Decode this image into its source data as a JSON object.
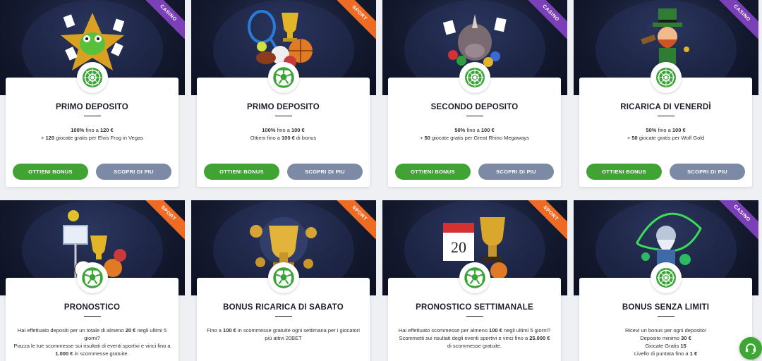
{
  "colors": {
    "accent_green": "#41a334",
    "button_grey": "#7d8aa5",
    "casino_ribbon": "#7b3fb8",
    "sport_ribbon": "#ef6a23",
    "hero_bg": "#141a30"
  },
  "cards": [
    {
      "ribbon": "CASINO",
      "ribbon_type": "casino",
      "icon": "roulette-icon",
      "art": "frog-casino-art",
      "title": "PRIMO DEPOSITO",
      "desc": [
        [
          {
            "t": "100%",
            "b": true
          },
          {
            "t": " fino a "
          },
          {
            "t": "120 €",
            "b": true
          }
        ],
        [
          {
            "t": "+ "
          },
          {
            "t": "120",
            "b": true
          },
          {
            "t": " giocate gratis per Elvis Frog in Vegas"
          }
        ]
      ],
      "buttons": {
        "primary": "OTTIENI BONUS",
        "secondary": "SCOPRI DI PIU"
      }
    },
    {
      "ribbon": "SPORT",
      "ribbon_type": "sport",
      "icon": "soccer-ball-icon",
      "art": "sports-balls-art",
      "title": "PRIMO DEPOSITO",
      "desc": [
        [
          {
            "t": "100%",
            "b": true
          },
          {
            "t": " fino a "
          },
          {
            "t": "100 €",
            "b": true
          }
        ],
        [
          {
            "t": "Ottieni fino a "
          },
          {
            "t": "100 €",
            "b": true
          },
          {
            "t": " di bonus"
          }
        ]
      ],
      "buttons": {
        "primary": "OTTIENI BONUS",
        "secondary": "SCOPRI DI PIU"
      }
    },
    {
      "ribbon": "CASINO",
      "ribbon_type": "casino",
      "icon": "roulette-icon",
      "art": "rhino-casino-art",
      "title": "SECONDO DEPOSITO",
      "desc": [
        [
          {
            "t": "50%",
            "b": true
          },
          {
            "t": " fino a "
          },
          {
            "t": "100 €",
            "b": true
          }
        ],
        [
          {
            "t": "+ "
          },
          {
            "t": "50",
            "b": true
          },
          {
            "t": " giocate gratis per Great Rhino Megaways"
          }
        ]
      ],
      "buttons": {
        "primary": "OTTIENI BONUS",
        "secondary": "SCOPRI DI PIU"
      }
    },
    {
      "ribbon": "CASINO",
      "ribbon_type": "casino",
      "icon": "roulette-icon",
      "art": "leprechaun-casino-art",
      "title": "RICARICA DI VENERDÌ",
      "desc": [
        [
          {
            "t": "50%",
            "b": true
          },
          {
            "t": " fino a "
          },
          {
            "t": "100 €",
            "b": true
          }
        ],
        [
          {
            "t": "+ "
          },
          {
            "t": "50",
            "b": true
          },
          {
            "t": " giocate gratis per Wolf Gold"
          }
        ]
      ],
      "buttons": {
        "primary": "OTTIENI BONUS",
        "secondary": "SCOPRI DI PIU"
      }
    },
    {
      "ribbon": "SPORT",
      "ribbon_type": "sport",
      "icon": "soccer-ball-icon",
      "art": "sports-equipment-art",
      "title": "PRONOSTICO",
      "desc": [
        [
          {
            "t": "Hai effettuato depositi per un totale di almeno "
          },
          {
            "t": "20 €",
            "b": true
          },
          {
            "t": " negli ultimi 5 giorni?"
          }
        ],
        [
          {
            "t": "Piazza le tue scommesse sui risultati di eventi sportivi e vinci fino a "
          },
          {
            "t": "1.000 €",
            "b": true
          },
          {
            "t": " in scommesse gratuite."
          }
        ]
      ]
    },
    {
      "ribbon": "SPORT",
      "ribbon_type": "sport",
      "icon": "soccer-ball-icon",
      "art": "golden-trophy-art",
      "title": "BONUS RICARICA DI SABATO",
      "desc": [
        [
          {
            "t": "Fino a "
          },
          {
            "t": "100 €",
            "b": true
          },
          {
            "t": " in scommesse gratuite ogni settimana per i giocatori più attivi 20BET"
          }
        ]
      ]
    },
    {
      "ribbon": "SPORT",
      "ribbon_type": "sport",
      "icon": "soccer-ball-icon",
      "art": "calendar-trophy-art",
      "title": "PRONOSTICO SETTIMANALE",
      "calendar_day": "20",
      "desc": [
        [
          {
            "t": "Hai effettuato scommesse per almeno "
          },
          {
            "t": "100 €",
            "b": true
          },
          {
            "t": " negli ultimi 5 giorni?"
          }
        ],
        [
          {
            "t": "Scommetti sui risultati degli eventi sportivi e vinci fino a "
          },
          {
            "t": "25.000 €",
            "b": true
          }
        ],
        [
          {
            "t": "di scommesse gratuite."
          }
        ]
      ]
    },
    {
      "ribbon": "CASINO",
      "ribbon_type": "casino",
      "icon": "roulette-icon",
      "art": "wizard-casino-art",
      "title": "BONUS SENZA LIMITI",
      "desc": [
        [
          {
            "t": "Ricevi un bonus per ogni deposito!"
          }
        ],
        [
          {
            "t": "Deposito minimo "
          },
          {
            "t": "30 €",
            "b": true
          }
        ],
        [
          {
            "t": "Giocate Gratis "
          },
          {
            "t": "15",
            "b": true
          }
        ],
        [
          {
            "t": "Livello di puntata fino a "
          },
          {
            "t": "1 €",
            "b": true
          }
        ]
      ]
    }
  ],
  "chat": {
    "icon": "headset-chat-icon"
  }
}
